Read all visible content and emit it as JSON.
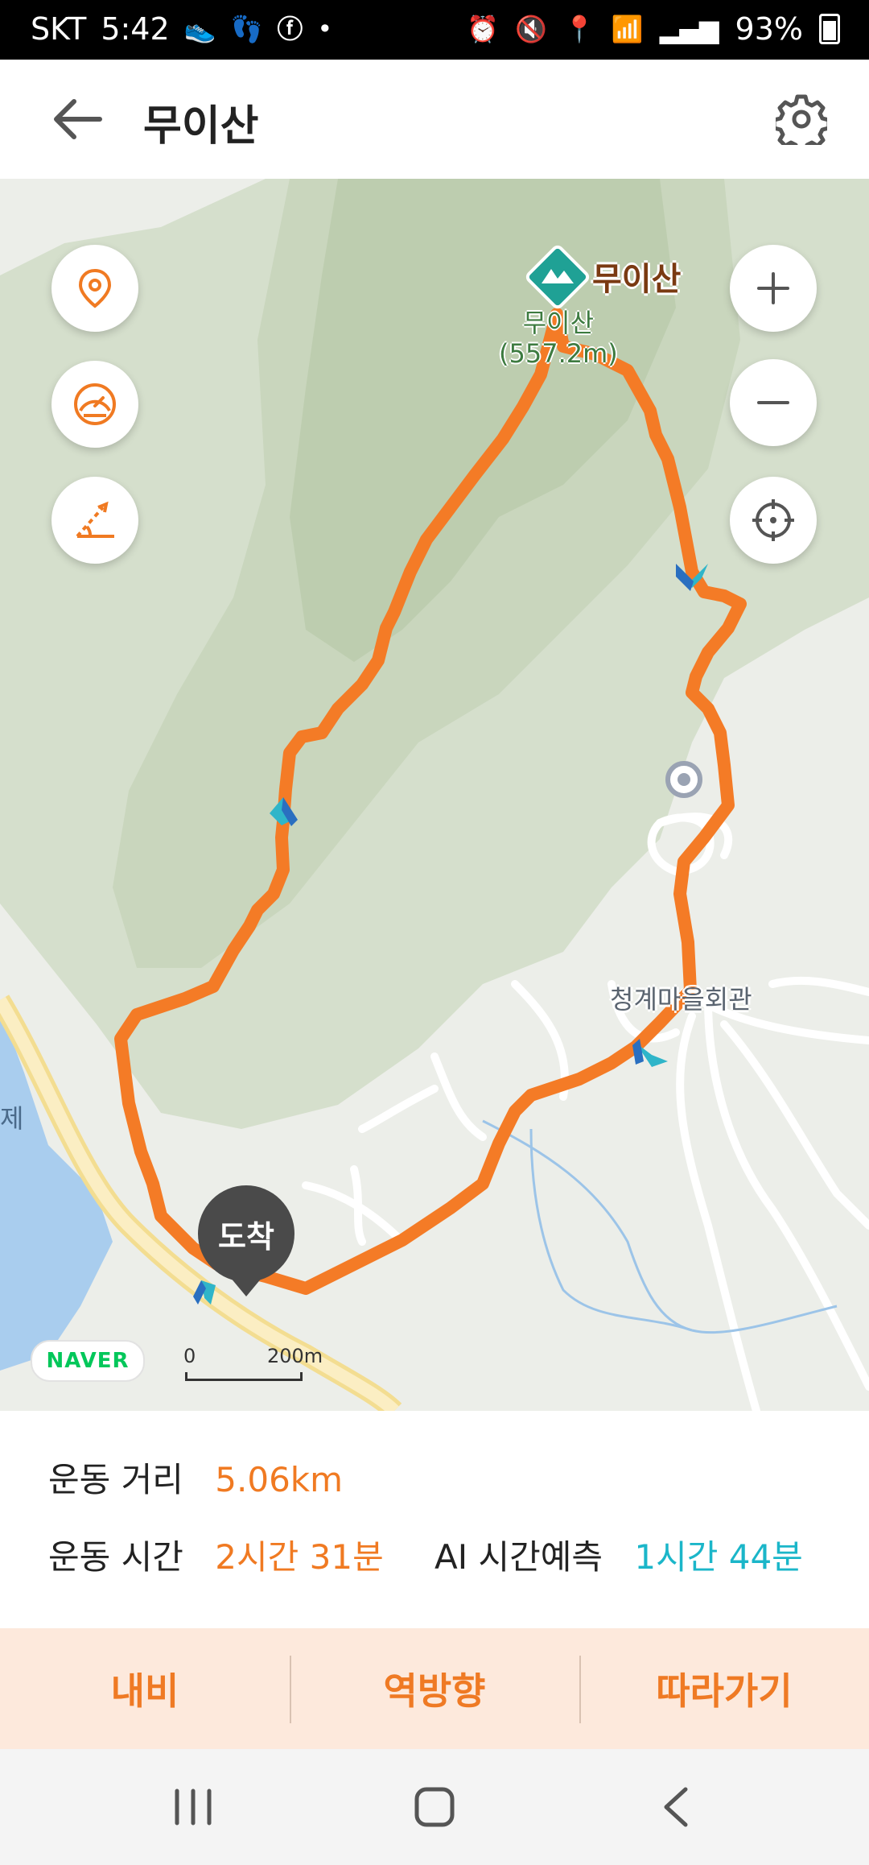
{
  "status_bar": {
    "carrier": "SKT",
    "time": "5:42",
    "battery": "93%",
    "left_icons": [
      "shoe-icon",
      "footprints-icon",
      "facebook-icon",
      "dot-icon"
    ],
    "right_icons": [
      "alarm-icon",
      "mute-icon",
      "location-icon",
      "wifi-icon",
      "signal-icon",
      "battery-icon"
    ]
  },
  "header": {
    "title": "무이산",
    "back_icon": "back-arrow-icon",
    "settings_icon": "gear-icon"
  },
  "map": {
    "peak_name": "무이산",
    "peak_label_line1": "무이산",
    "peak_label_line2": "(557.2m)",
    "village_label": "청계마을회관",
    "side_label": "제",
    "arrive_label": "도착",
    "naver_logo": "NAVER",
    "scale_zero": "0",
    "scale_distance": "200m",
    "route_color": "#f47b26",
    "left_controls": [
      "location-pin-icon",
      "speedometer-icon",
      "slope-icon"
    ],
    "right_controls": [
      "zoom-in-icon",
      "zoom-out-icon",
      "crosshair-icon"
    ]
  },
  "stats": {
    "distance_label": "운동 거리",
    "distance_value": "5.06km",
    "time_label": "운동 시간",
    "time_value": "2시간 31분",
    "ai_label": "AI 시간예측",
    "ai_value": "1시간 44분"
  },
  "actions": {
    "navi": "내비",
    "reverse": "역방향",
    "follow": "따라가기"
  },
  "nav_bar": [
    "recent-apps-icon",
    "home-icon",
    "back-icon"
  ]
}
